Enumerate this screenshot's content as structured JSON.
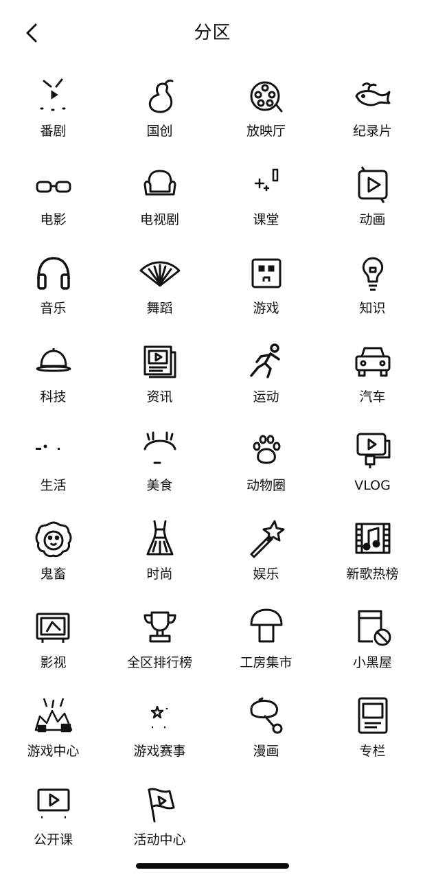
{
  "header": {
    "back_icon": "chevron-left-icon",
    "title": "分区"
  },
  "categories": [
    {
      "label": "番剧",
      "icon": "bangumi-icon"
    },
    {
      "label": "国创",
      "icon": "gourd-icon"
    },
    {
      "label": "放映厅",
      "icon": "film-reel-icon"
    },
    {
      "label": "纪录片",
      "icon": "whale-icon"
    },
    {
      "label": "电影",
      "icon": "glasses-icon"
    },
    {
      "label": "电视剧",
      "icon": "sofa-icon"
    },
    {
      "label": "课堂",
      "icon": "sparkle-pencil-icon"
    },
    {
      "label": "动画",
      "icon": "animation-icon"
    },
    {
      "label": "音乐",
      "icon": "headphones-icon"
    },
    {
      "label": "舞蹈",
      "icon": "fan-icon"
    },
    {
      "label": "游戏",
      "icon": "game-face-icon"
    },
    {
      "label": "知识",
      "icon": "lightbulb-icon"
    },
    {
      "label": "科技",
      "icon": "bell-dome-icon"
    },
    {
      "label": "资讯",
      "icon": "news-icon"
    },
    {
      "label": "运动",
      "icon": "runner-icon"
    },
    {
      "label": "汽车",
      "icon": "car-icon"
    },
    {
      "label": "生活",
      "icon": "life-icon"
    },
    {
      "label": "美食",
      "icon": "food-icon"
    },
    {
      "label": "动物圈",
      "icon": "paw-icon"
    },
    {
      "label": "VLOG",
      "icon": "vlog-camera-icon"
    },
    {
      "label": "鬼畜",
      "icon": "lion-face-icon"
    },
    {
      "label": "时尚",
      "icon": "dress-icon"
    },
    {
      "label": "娱乐",
      "icon": "magic-wand-icon"
    },
    {
      "label": "新歌热榜",
      "icon": "music-film-icon"
    },
    {
      "label": "影视",
      "icon": "tv-frame-icon"
    },
    {
      "label": "全区排行榜",
      "icon": "trophy-icon"
    },
    {
      "label": "工房集市",
      "icon": "mushroom-icon"
    },
    {
      "label": "小黑屋",
      "icon": "banned-icon"
    },
    {
      "label": "游戏中心",
      "icon": "game-center-icon"
    },
    {
      "label": "游戏赛事",
      "icon": "star-icon"
    },
    {
      "label": "漫画",
      "icon": "comic-icon"
    },
    {
      "label": "专栏",
      "icon": "article-icon"
    },
    {
      "label": "公开课",
      "icon": "play-screen-icon"
    },
    {
      "label": "活动中心",
      "icon": "flag-icon"
    }
  ]
}
